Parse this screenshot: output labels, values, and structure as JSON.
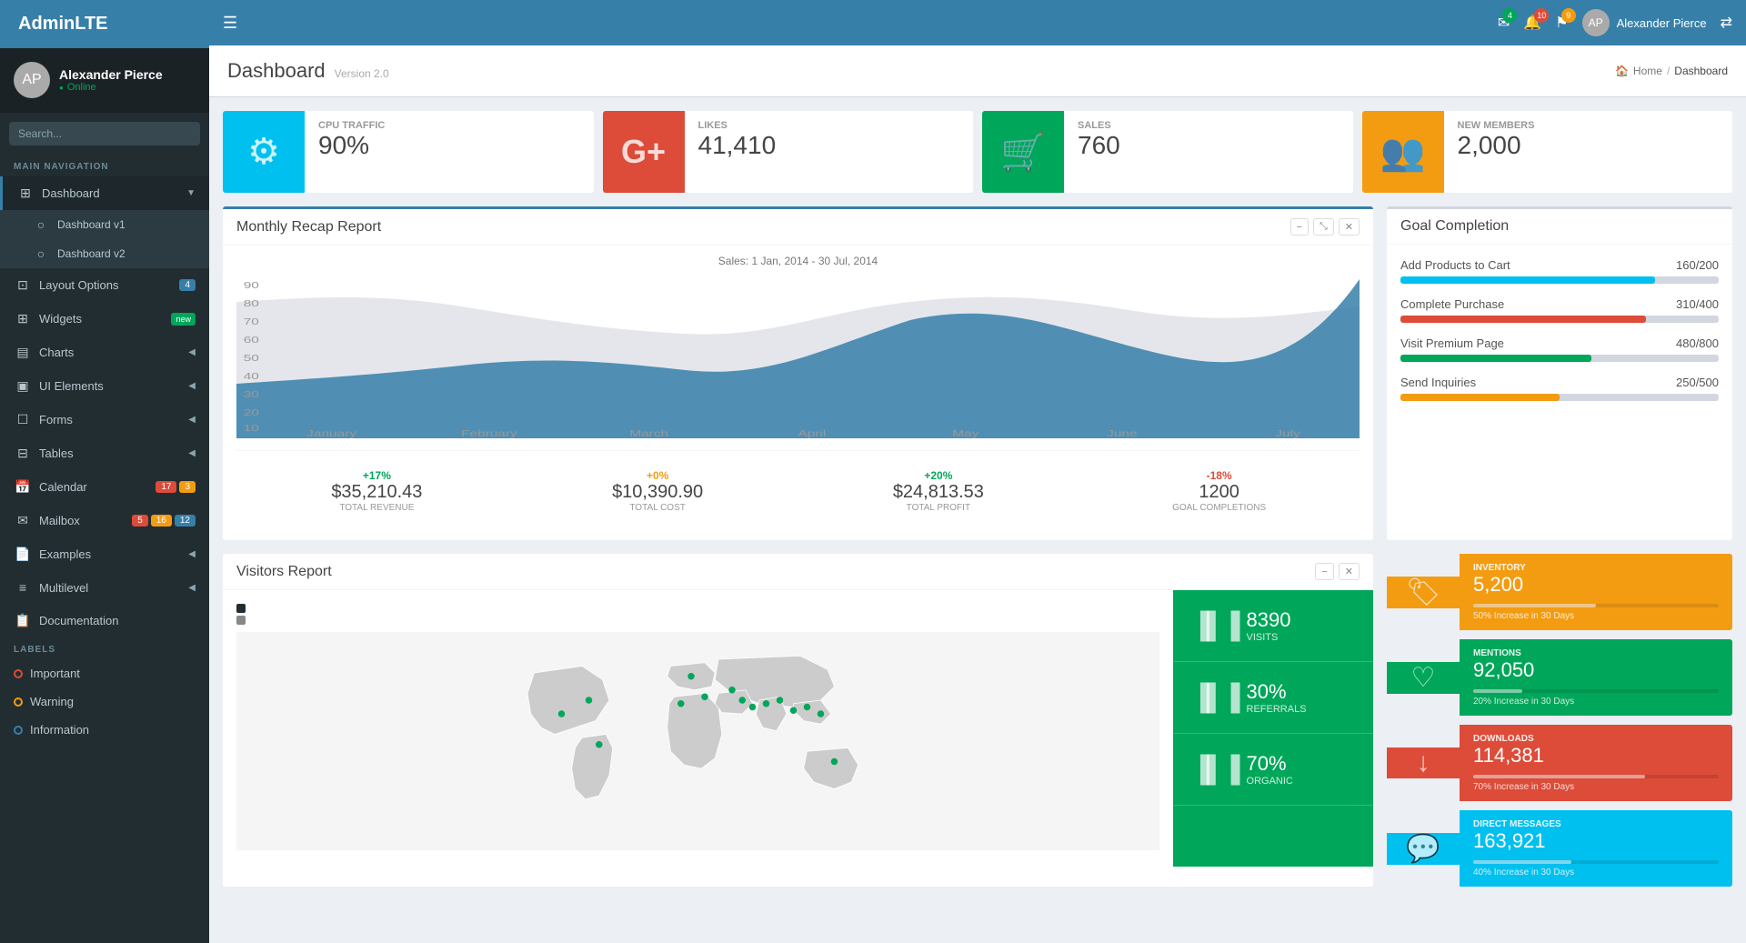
{
  "app": {
    "name": "AdminLTE",
    "version": "Version 2.0"
  },
  "topnav": {
    "hamburger": "☰",
    "user_name": "Alexander Pierce",
    "icons": {
      "mail": "✉",
      "bell": "🔔",
      "flag": "⚑",
      "share": "⇄"
    },
    "badges": {
      "mail": "4",
      "bell": "10",
      "flag": "9"
    }
  },
  "sidebar": {
    "user": {
      "name": "Alexander Pierce",
      "status": "Online"
    },
    "search_placeholder": "Search...",
    "nav_label": "MAIN NAVIGATION",
    "items": [
      {
        "id": "dashboard",
        "label": "Dashboard",
        "icon": "⊞",
        "active": true,
        "has_sub": true
      },
      {
        "id": "dashboard-v1",
        "label": "Dashboard v1",
        "icon": "○",
        "sub": true
      },
      {
        "id": "dashboard-v2",
        "label": "Dashboard v2",
        "icon": "○",
        "sub": true
      },
      {
        "id": "layout-options",
        "label": "Layout Options",
        "icon": "⊡",
        "badge": "4",
        "badge_color": "blue"
      },
      {
        "id": "widgets",
        "label": "Widgets",
        "icon": "⊞",
        "badge": "new",
        "badge_color": "new"
      },
      {
        "id": "charts",
        "label": "Charts",
        "icon": "▤",
        "has_sub": true
      },
      {
        "id": "ui-elements",
        "label": "UI Elements",
        "icon": "▣",
        "has_sub": true
      },
      {
        "id": "forms",
        "label": "Forms",
        "icon": "☐",
        "has_sub": true
      },
      {
        "id": "tables",
        "label": "Tables",
        "icon": "⊟",
        "has_sub": true
      },
      {
        "id": "calendar",
        "label": "Calendar",
        "icon": "📅",
        "badge1": "17",
        "badge1_color": "red",
        "badge2": "3",
        "badge2_color": "yellow"
      },
      {
        "id": "mailbox",
        "label": "Mailbox",
        "icon": "✉",
        "badge1": "5",
        "badge1_color": "red",
        "badge2": "16",
        "badge2_color": "yellow",
        "badge3": "12",
        "badge3_color": "blue"
      },
      {
        "id": "examples",
        "label": "Examples",
        "icon": "📄",
        "has_sub": true
      },
      {
        "id": "multilevel",
        "label": "Multilevel",
        "icon": "≡",
        "has_sub": true
      },
      {
        "id": "documentation",
        "label": "Documentation",
        "icon": "📋"
      }
    ],
    "labels_title": "LABELS",
    "labels": [
      {
        "id": "important",
        "label": "Important",
        "color": "red"
      },
      {
        "id": "warning",
        "label": "Warning",
        "color": "yellow"
      },
      {
        "id": "information",
        "label": "Information",
        "color": "blue"
      }
    ]
  },
  "breadcrumb": {
    "home": "Home",
    "current": "Dashboard"
  },
  "info_boxes": [
    {
      "id": "cpu",
      "icon": "⚙",
      "color": "aqua",
      "label": "CPU TRAFFIC",
      "value": "90%"
    },
    {
      "id": "likes",
      "icon": "G+",
      "color": "red",
      "label": "LIKES",
      "value": "41,410"
    },
    {
      "id": "sales",
      "icon": "🛒",
      "color": "green",
      "label": "SALES",
      "value": "760"
    },
    {
      "id": "members",
      "icon": "👥",
      "color": "yellow",
      "label": "NEW MEMBERS",
      "value": "2,000"
    }
  ],
  "monthly_report": {
    "title": "Monthly Recap Report",
    "chart_title": "Sales: 1 Jan, 2014 - 30 Jul, 2014",
    "x_labels": [
      "January",
      "February",
      "March",
      "April",
      "May",
      "June",
      "July"
    ],
    "stats": [
      {
        "change": "+17%",
        "change_color": "green",
        "value": "$35,210.43",
        "label": "TOTAL REVENUE"
      },
      {
        "change": "+0%",
        "change_color": "orange",
        "value": "$10,390.90",
        "label": "TOTAL COST"
      },
      {
        "change": "+20%",
        "change_color": "green",
        "value": "$24,813.53",
        "label": "TOTAL PROFIT"
      },
      {
        "change": "-18%",
        "change_color": "red",
        "value": "1200",
        "label": "GOAL COMPLETIONS"
      }
    ]
  },
  "goal_completion": {
    "title": "Goal Completion",
    "goals": [
      {
        "label": "Add Products to Cart",
        "value": "160/200",
        "percent": 80,
        "color": "aqua"
      },
      {
        "label": "Complete Purchase",
        "value": "310/400",
        "percent": 77,
        "color": "red"
      },
      {
        "label": "Visit Premium Page",
        "value": "480/800",
        "percent": 60,
        "color": "green"
      },
      {
        "label": "Send Inquiries",
        "value": "250/500",
        "percent": 50,
        "color": "yellow"
      }
    ]
  },
  "visitors_report": {
    "title": "Visitors Report",
    "stats": [
      {
        "icon": "▐▌▐",
        "value": "8390",
        "label": "VISITS"
      },
      {
        "icon": "▐▌▐",
        "value": "30%",
        "label": "REFERRALS"
      },
      {
        "icon": "▐▌▐",
        "value": "70%",
        "label": "ORGANIC"
      }
    ]
  },
  "right_stats": [
    {
      "id": "inventory",
      "icon": "🏷",
      "color": "yellow",
      "label": "INVENTORY",
      "value": "5,200",
      "bar": 50,
      "footer": "50% Increase in 30 Days"
    },
    {
      "id": "mentions",
      "icon": "♡",
      "color": "green",
      "label": "MENTIONS",
      "value": "92,050",
      "bar": 20,
      "footer": "20% Increase in 30 Days"
    },
    {
      "id": "downloads",
      "icon": "↓",
      "color": "red",
      "label": "DOWNLOADS",
      "value": "114,381",
      "bar": 70,
      "footer": "70% Increase in 30 Days"
    },
    {
      "id": "direct-messages",
      "icon": "💬",
      "color": "aqua",
      "label": "DIRECT MESSAGES",
      "value": "163,921",
      "bar": 40,
      "footer": "40% Increase in 30 Days"
    }
  ]
}
